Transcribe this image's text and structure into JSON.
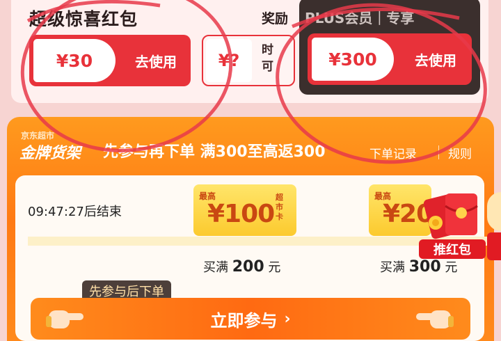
{
  "top": {
    "title": "超级惊喜红包",
    "reward_tail": "奖励",
    "coupon_1": {
      "amount": "¥30",
      "action": "去使用"
    },
    "coupon_2": {
      "amount": "¥?",
      "side_line_1": "时",
      "side_line_2": "可"
    },
    "vip": {
      "title": "PLUS会员｜专享",
      "amount": "¥300",
      "action": "去使用"
    }
  },
  "gold": {
    "brand_small": "京东超市",
    "brand_main": "金牌货架",
    "promo": "先参与再下单  满300至高返300",
    "order_record": "下单记录",
    "rules": "规则",
    "countdown": "09:47:27后结束",
    "tickets": [
      {
        "max": "最高",
        "amount": "¥100",
        "type": "超市卡",
        "threshold_prefix": "买满",
        "threshold_value": "200",
        "threshold_unit": "元"
      },
      {
        "max": "最高",
        "amount": "¥20",
        "type": "",
        "threshold_prefix": "买满",
        "threshold_value": "300",
        "threshold_unit": "元"
      }
    ],
    "hongbao_label": "推红包",
    "tip": "先参与后下单",
    "join_button": "立即参与",
    "join_chevron": "›"
  },
  "colors": {
    "coupon_red": "#e8323a",
    "gold_orange": "#ff8a1c",
    "vip_dark": "#3b2f2d",
    "annotation_circle": "#e83a4a"
  }
}
